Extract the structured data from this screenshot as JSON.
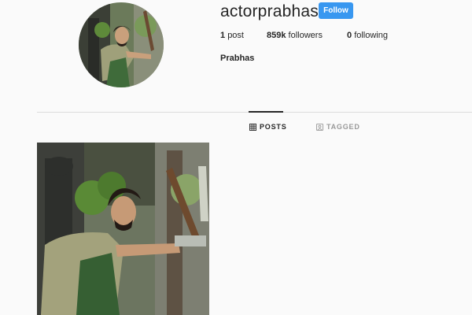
{
  "profile": {
    "username": "actorprabhas",
    "follow_label": "Follow",
    "full_name": "Prabhas",
    "stats": {
      "posts_count": "1",
      "posts_label": "post",
      "followers_count": "859k",
      "followers_label": "followers",
      "following_count": "0",
      "following_label": "following"
    }
  },
  "tabs": [
    {
      "label": "POSTS",
      "icon": "grid-icon",
      "active": true
    },
    {
      "label": "TAGGED",
      "icon": "tag-icon",
      "active": false
    }
  ],
  "colors": {
    "background": "#fafafa",
    "follow_button": "#3897f0",
    "text": "#262626",
    "muted": "#999999",
    "divider": "#dbdbdb"
  }
}
